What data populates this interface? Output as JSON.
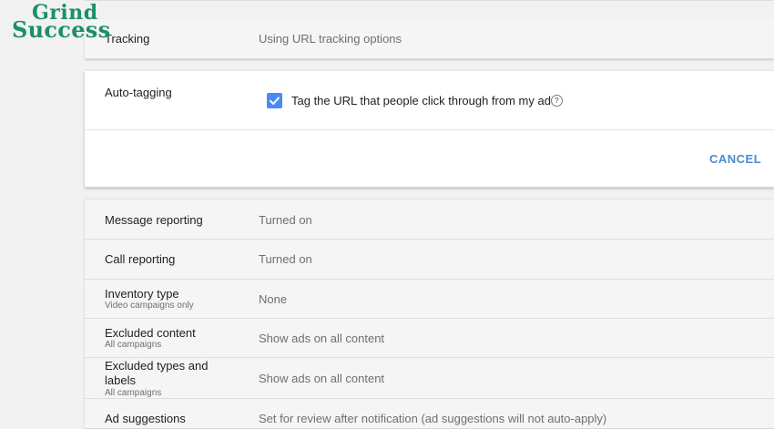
{
  "logo": {
    "line1": "Grind",
    "line2": "Success"
  },
  "tracking": {
    "label": "Tracking",
    "value": "Using URL tracking options"
  },
  "auto_tagging": {
    "label": "Auto-tagging",
    "checkbox_label": "Tag the URL that people click through from my ad",
    "checked": true,
    "help_icon": "?",
    "cancel_label": "CANCEL"
  },
  "settings": [
    {
      "label": "Message reporting",
      "sublabel": "",
      "value": "Turned on"
    },
    {
      "label": "Call reporting",
      "sublabel": "",
      "value": "Turned on"
    },
    {
      "label": "Inventory type",
      "sublabel": "Video campaigns only",
      "value": "None"
    },
    {
      "label": "Excluded content",
      "sublabel": "All campaigns",
      "value": "Show ads on all content"
    },
    {
      "label": "Excluded types and labels",
      "sublabel": "All campaigns",
      "value": "Show ads on all content"
    },
    {
      "label": "Ad suggestions",
      "sublabel": "",
      "value": "Set for review after notification (ad suggestions will not auto-apply)"
    }
  ],
  "colors": {
    "accent": "#4a8af4",
    "cancel": "#4a8ad0",
    "logo": "#1b8f6a"
  }
}
